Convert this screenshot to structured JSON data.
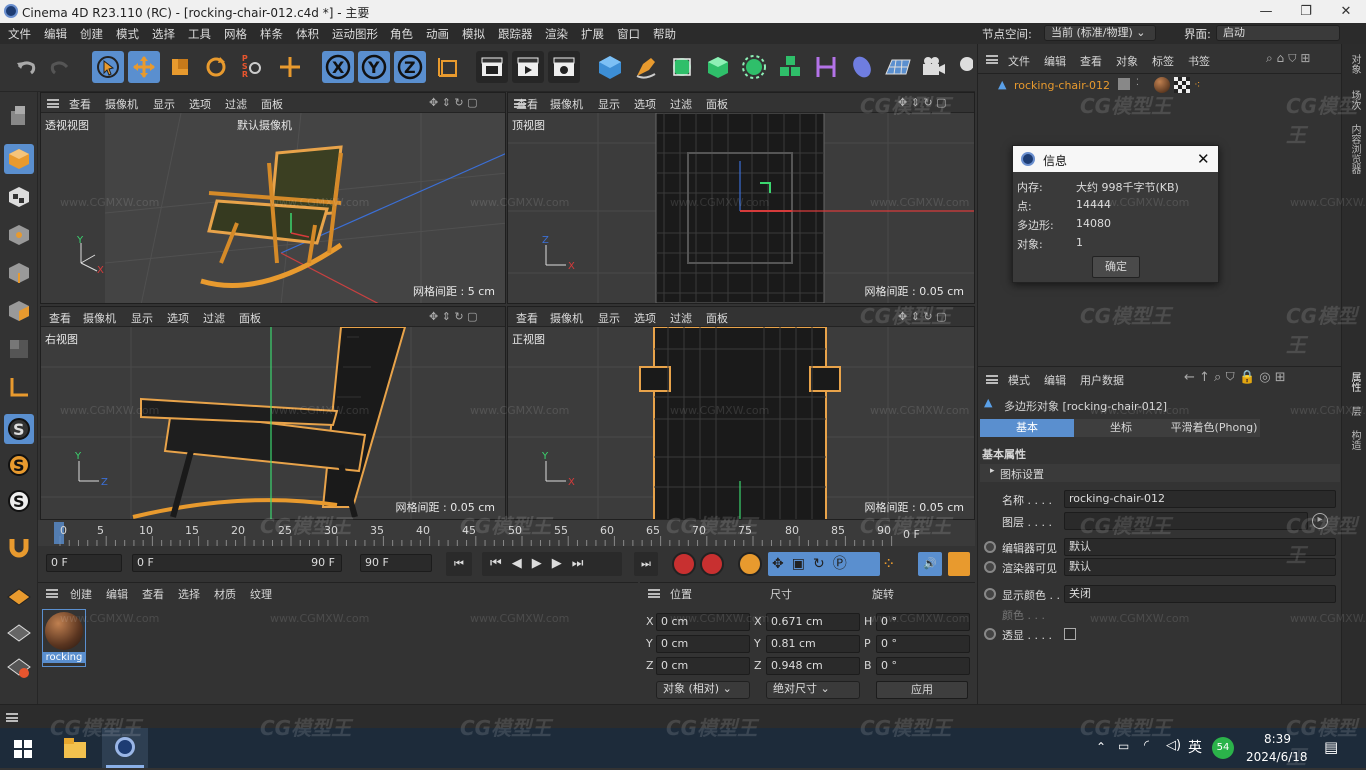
{
  "app": {
    "title": "Cinema 4D R23.110 (RC) - [rocking-chair-012.c4d *] - 主要"
  },
  "menu": [
    "文件",
    "编辑",
    "创建",
    "模式",
    "选择",
    "工具",
    "网格",
    "样条",
    "体积",
    "运动图形",
    "角色",
    "动画",
    "模拟",
    "跟踪器",
    "渲染",
    "扩展",
    "窗口",
    "帮助"
  ],
  "node_space": {
    "label": "节点空间:",
    "value": "当前 (标准/物理)"
  },
  "layout": {
    "label": "界面:",
    "value": "启动"
  },
  "viewport_menu": [
    "查看",
    "摄像机",
    "显示",
    "选项",
    "过滤",
    "面板"
  ],
  "viewports": [
    {
      "name": "透视视图",
      "camera": "默认摄像机",
      "grid": "网格间距 : 5 cm"
    },
    {
      "name": "顶视图",
      "grid": "网格间距 : 0.05 cm"
    },
    {
      "name": "右视图",
      "grid": "网格间距 : 0.05 cm"
    },
    {
      "name": "正视图",
      "grid": "网格间距 : 0.05 cm"
    }
  ],
  "timeline": {
    "ticks": [
      "0",
      "5",
      "10",
      "15",
      "20",
      "25",
      "30",
      "35",
      "40",
      "45",
      "50",
      "55",
      "60",
      "65",
      "70",
      "75",
      "80",
      "85",
      "90"
    ],
    "end_label": "0 F"
  },
  "transport": {
    "start": "0 F",
    "range_start": "0 F",
    "range_end": "90 F",
    "end": "90 F"
  },
  "material_panel": {
    "menu": [
      "创建",
      "编辑",
      "查看",
      "选择",
      "材质",
      "纹理"
    ],
    "material_name": "rocking"
  },
  "coord_panel": {
    "headers": [
      "位置",
      "尺寸",
      "旋转"
    ],
    "rows": [
      {
        "axis": "X",
        "pos": "0 cm",
        "size_axis": "X",
        "size": "0.671 cm",
        "rot_axis": "H",
        "rot": "0 °"
      },
      {
        "axis": "Y",
        "pos": "0 cm",
        "size_axis": "Y",
        "size": "0.81 cm",
        "rot_axis": "P",
        "rot": "0 °"
      },
      {
        "axis": "Z",
        "pos": "0 cm",
        "size_axis": "Z",
        "size": "0.948 cm",
        "rot_axis": "B",
        "rot": "0 °"
      }
    ],
    "mode_dropdown": "对象 (相对)",
    "size_dropdown": "绝对尺寸",
    "apply_label": "应用"
  },
  "object_manager": {
    "menu": [
      "文件",
      "编辑",
      "查看",
      "对象",
      "标签",
      "书签"
    ],
    "object_name": "rocking-chair-012"
  },
  "info_dialog": {
    "title": "信息",
    "rows": [
      {
        "label": "内存:",
        "value": "大约 998千字节(KB)"
      },
      {
        "label": "点:",
        "value": "14444"
      },
      {
        "label": "多边形:",
        "value": "14080"
      },
      {
        "label": "对象:",
        "value": "1"
      }
    ],
    "ok_label": "确定"
  },
  "attributes": {
    "menu": [
      "模式",
      "编辑",
      "用户数据"
    ],
    "object_title": "多边形对象 [rocking-chair-012]",
    "tabs": [
      "基本",
      "坐标",
      "平滑着色(Phong)"
    ],
    "section": "基本属性",
    "group": "图标设置",
    "name_label": "名称 . . . .",
    "name_value": "rocking-chair-012",
    "layer_label": "图层 . . . .",
    "editor_visible_label": "编辑器可见",
    "editor_visible_value": "默认",
    "render_visible_label": "渲染器可见",
    "render_visible_value": "默认",
    "display_color_label": "显示颜色 . .",
    "display_color_value": "关闭",
    "color_label": "颜色 . . .",
    "transparency_label": "透显 . . . ."
  },
  "sidebar_tabs": [
    "对象",
    "场次",
    "内容浏览器",
    "属性",
    "层",
    "构造"
  ],
  "taskbar": {
    "time": "8:39",
    "date": "2024/6/18",
    "ime": "英",
    "badge": "54"
  },
  "watermark": {
    "logo": "CG模型王",
    "url": "www.CGMXW.com"
  },
  "colors": {
    "accent": "#5a8fcf",
    "orange": "#e89a2e",
    "panel": "#333333"
  }
}
